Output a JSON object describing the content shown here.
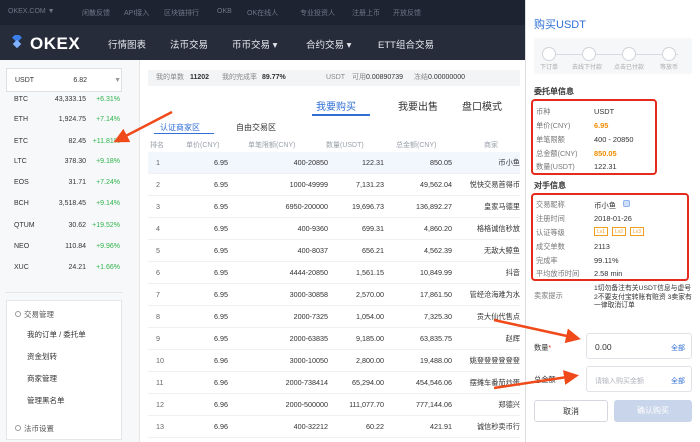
{
  "topbar": {
    "items": [
      "OKEX.COM ▼",
      "闲散反馈",
      "API接入",
      "区块链排行",
      "OKB",
      "OK在线人",
      "专业投资人",
      "注册上币",
      "开放反馈"
    ]
  },
  "nav": {
    "logo": "OKEX",
    "items": [
      "行情图表",
      "法币交易",
      "币币交易 ▾",
      "合约交易 ▾",
      "ETT组合交易"
    ]
  },
  "coins": [
    {
      "sym": "USDT",
      "price": "6.82",
      "chg": "▼"
    },
    {
      "sym": "BTC",
      "price": "43,333.15",
      "chg": "+6.31%"
    },
    {
      "sym": "ETH",
      "price": "1,924.75",
      "chg": "+7.14%"
    },
    {
      "sym": "ETC",
      "price": "82.45",
      "chg": "+11.81%"
    },
    {
      "sym": "LTC",
      "price": "378.30",
      "chg": "+9.18%"
    },
    {
      "sym": "EOS",
      "price": "31.71",
      "chg": "+7.24%"
    },
    {
      "sym": "BCH",
      "price": "3,518.45",
      "chg": "+9.14%"
    },
    {
      "sym": "QTUM",
      "price": "30.62",
      "chg": "+19.52%"
    },
    {
      "sym": "NEO",
      "price": "110.84",
      "chg": "+9.96%"
    },
    {
      "sym": "XUC",
      "price": "24.21",
      "chg": "+1.66%"
    }
  ],
  "mgmt": {
    "title": "交易管理",
    "items": [
      "我的订单 / 委托单",
      "资金划转",
      "商家管理",
      "管理黑名单"
    ],
    "footer": "法币设置"
  },
  "stats": {
    "orders_label": "我的单数",
    "orders": "11202",
    "rate_label": "我的完成率",
    "rate": "89.77%",
    "currency": "USDT",
    "avail_label": "可用",
    "avail": "0.00890739",
    "frozen_label": "冻结",
    "frozen": "0.00000000"
  },
  "trade_tabs": [
    "我要购买",
    "我要出售",
    "盘口模式"
  ],
  "sub_tabs": [
    "认证商家区",
    "自由交易区"
  ],
  "table": {
    "headers": [
      "排名",
      "单价(CNY)",
      "单笔限额(CNY)",
      "数量(USDT)",
      "总金额(CNY)",
      "商家"
    ],
    "rows": [
      [
        "1",
        "6.95",
        "400-20850",
        "122.31",
        "850.05",
        "币小鱼"
      ],
      [
        "2",
        "6.95",
        "1000-49999",
        "7,131.23",
        "49,562.04",
        "悦快交易首得币"
      ],
      [
        "3",
        "6.95",
        "6950-200000",
        "19,696.73",
        "136,892.27",
        "皇家马德里"
      ],
      [
        "4",
        "6.95",
        "400-9360",
        "699.31",
        "4,860.20",
        "格格诚信秒放"
      ],
      [
        "5",
        "6.95",
        "400-8037",
        "656.21",
        "4,562.39",
        "无敌大鲸鱼"
      ],
      [
        "6",
        "6.95",
        "4444-20850",
        "1,561.15",
        "10,849.99",
        "抖音"
      ],
      [
        "7",
        "6.95",
        "3000-30858",
        "2,570.00",
        "17,861.50",
        "管经沧海难为水"
      ],
      [
        "8",
        "6.95",
        "2000-7325",
        "1,054.00",
        "7,325.30",
        "贡大仙代售点"
      ],
      [
        "9",
        "6.95",
        "2000-63835",
        "9,185.00",
        "63,835.75",
        "赵辉"
      ],
      [
        "10",
        "6.96",
        "3000-10050",
        "2,800.00",
        "19,488.00",
        "姚登登登登登登"
      ],
      [
        "11",
        "6.96",
        "2000-738414",
        "65,294.00",
        "454,546.06",
        "摆摊车番茄炒蛋"
      ],
      [
        "12",
        "6.96",
        "2000-500000",
        "111,077.70",
        "777,144.06",
        "郑德兴"
      ],
      [
        "13",
        "6.96",
        "400-32212",
        "60.22",
        "421.91",
        "诚信秒卖币行"
      ]
    ]
  },
  "panel": {
    "title": "购买USDT",
    "steps": [
      "下订单",
      "去线下付款",
      "点击已付款",
      "等放币"
    ],
    "order_title": "委托单信息",
    "order": [
      {
        "k": "币种",
        "v": "USDT"
      },
      {
        "k": "单价(CNY)",
        "v": "6.95"
      },
      {
        "k": "单笔限额",
        "v": "400 - 20850"
      },
      {
        "k": "总金额(CNY)",
        "v": "850.05"
      },
      {
        "k": "数量(USDT)",
        "v": "122.31"
      }
    ],
    "party_title": "对手信息",
    "party": [
      {
        "k": "交易昵称",
        "v": "币小鱼"
      },
      {
        "k": "注册时间",
        "v": "2018-01-26"
      },
      {
        "k": "认证等级",
        "v": ""
      },
      {
        "k": "成交单数",
        "v": "2113"
      },
      {
        "k": "完成率",
        "v": "99.11%"
      },
      {
        "k": "平均放币时间",
        "v": "2.58 min"
      }
    ],
    "badges": [
      "Lv1",
      "Lv2",
      "Lv3"
    ],
    "remark_label": "卖家提示",
    "remark": "1切勿备注有关USDT信息与虚号 2不要支付宝转账有赃资 3卖家有一律取消订单",
    "qty_label": "数量",
    "qty_value": "0.00",
    "all_label": "全部",
    "amount_label": "总金额",
    "amount_placeholder": "请输入购买金额",
    "cancel": "取消",
    "confirm": "确认购买"
  },
  "colors": {
    "accent": "#e52b1e",
    "green": "#2eb34a",
    "blue": "#2f6fd6",
    "orange": "#f08c00"
  }
}
